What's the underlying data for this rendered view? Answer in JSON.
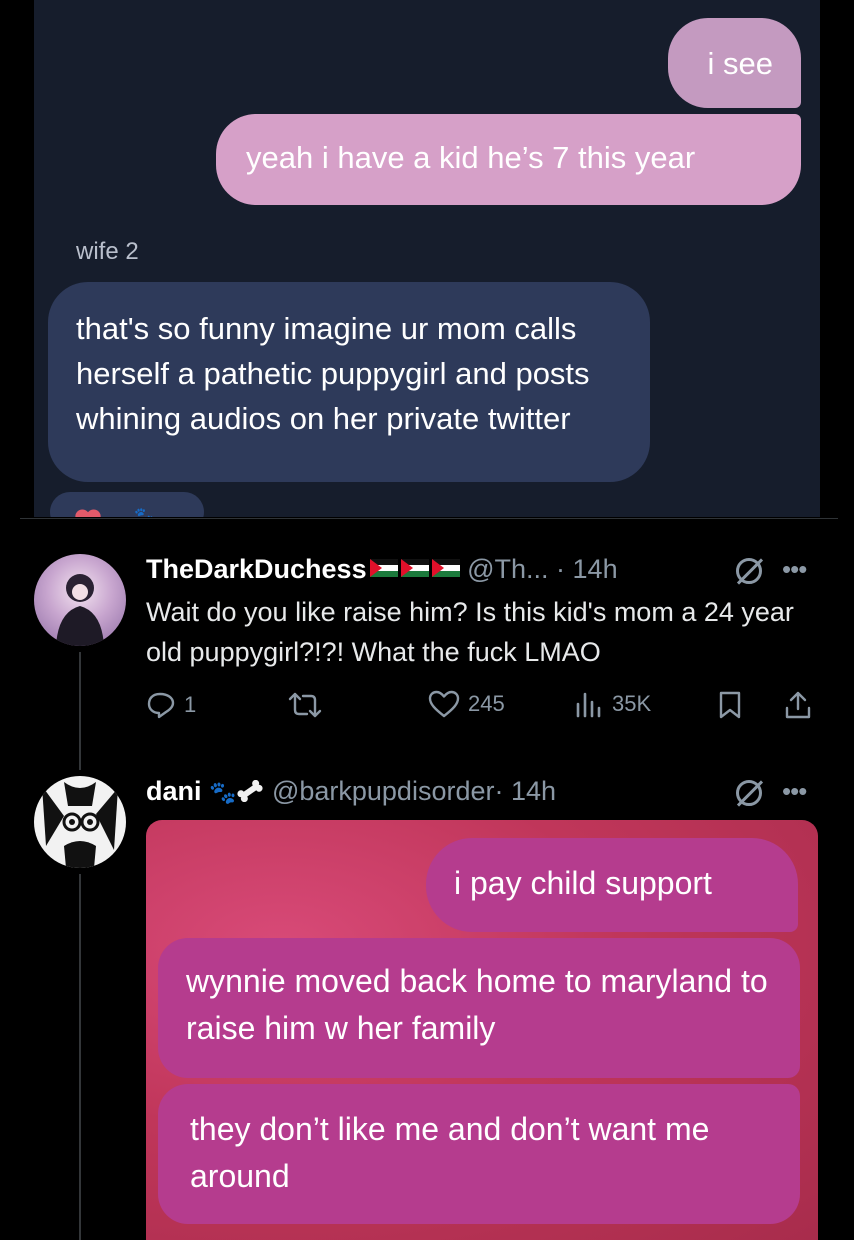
{
  "dm_top": {
    "msg_see": "i see",
    "msg_kid": "yeah i have a kid he’s 7 this year",
    "sender_label": "wife 2",
    "msg_funny": "that's so funny imagine ur mom calls herself a pathetic puppygirl and posts whining audios on her private twitter"
  },
  "tweet1": {
    "name": "TheDarkDuchess",
    "handle": "@Th...",
    "time": "· 14h",
    "body": "Wait do you like raise him? Is this kid's mom a 24 year old puppygirl?!?! What the fuck LMAO",
    "replies": "1",
    "likes": "245",
    "views": "35K"
  },
  "tweet2": {
    "name": "dani",
    "handle": "@barkpupdisorder",
    "time": "· 14h",
    "dm": {
      "msg_support": "i pay child support",
      "msg_wynnie": "wynnie moved back home to maryland to raise him w her family",
      "msg_dont": "they don’t like me and don’t want me around"
    }
  },
  "colors": {
    "dm_top_bg": "#161d2c",
    "bubble_sent": "#d6a0c8",
    "bubble_received": "#2e3a5a",
    "dm_bottom_bg": "#c0365a",
    "bubble_pink": "#b53c8e",
    "muted": "#8b98a5"
  }
}
